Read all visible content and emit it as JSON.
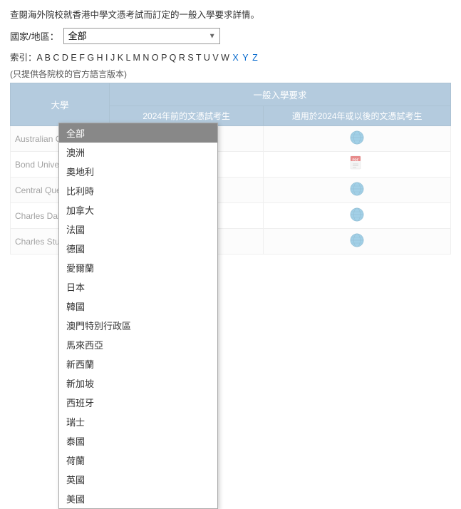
{
  "intro": {
    "text": "查閱海外院校就香港中學文憑考試而訂定的一般入學要求詳情。",
    "link_text": "詳情"
  },
  "filter": {
    "label": "國家/地區：",
    "selected": "全部",
    "options": [
      "全部",
      "澳洲",
      "奧地利",
      "比利時",
      "加拿大",
      "法國",
      "德國",
      "愛爾蘭",
      "日本",
      "韓國",
      "澳門特別行政區",
      "馬來西亞",
      "新西蘭",
      "新加坡",
      "西班牙",
      "瑞士",
      "泰國",
      "荷蘭",
      "英國",
      "美國"
    ]
  },
  "index": {
    "label": "索引：",
    "letters": [
      "A",
      "B",
      "C",
      "D",
      "E",
      "F",
      "G",
      "H",
      "I",
      "J",
      "K",
      "L",
      "M",
      "N",
      "O",
      "P",
      "Q",
      "R",
      "S",
      "T",
      "U",
      "V",
      "W",
      "X",
      "Y",
      "Z"
    ]
  },
  "note": {
    "text": "(只提供各院校的官方語言版本)"
  },
  "table": {
    "col_uni": "大學",
    "header_req": "一般入學要求",
    "col_before": "2024年前的文憑試考生",
    "col_after": "適用於2024年或以後的文憑試考生",
    "rows": [
      {
        "name": "Australian C University",
        "before_type": "pdf",
        "after_type": "globe"
      },
      {
        "name": "Bond Unive...",
        "before_type": "pdf",
        "after_type": "pdf"
      },
      {
        "name": "Central Que University",
        "before_type": "pdf",
        "after_type": "globe"
      },
      {
        "name": "Charles Dal University",
        "before_type": "pdf",
        "after_type": "globe"
      },
      {
        "name": "Charles Stu University",
        "before_type": "pdf",
        "after_type": "globe"
      }
    ]
  },
  "colors": {
    "header_bg": "#5b8db8",
    "selected_bg": "#888888"
  }
}
